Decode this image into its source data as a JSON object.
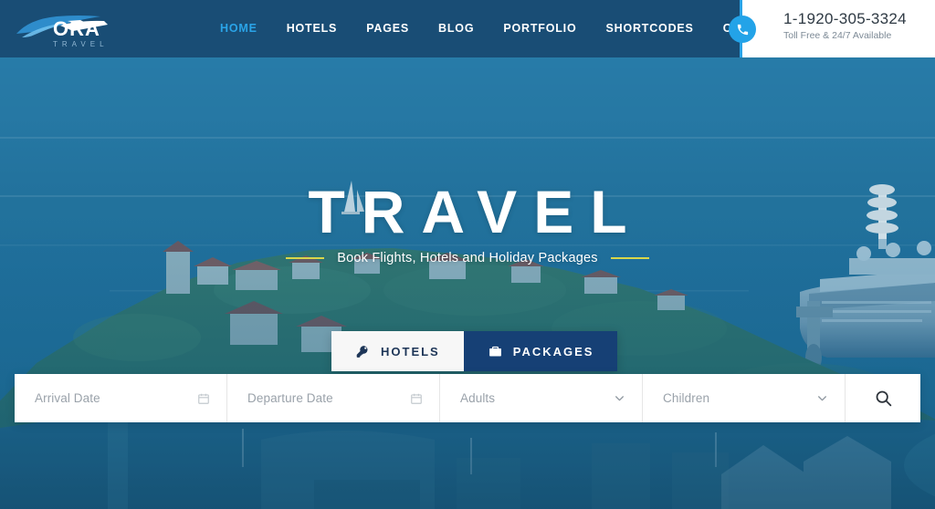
{
  "header": {
    "logo": {
      "name": "ORA",
      "tagline": "TRAVEL",
      "icon": "airplane-logo-icon"
    },
    "nav": [
      {
        "label": "HOME",
        "active": true
      },
      {
        "label": "HOTELS",
        "active": false
      },
      {
        "label": "PAGES",
        "active": false
      },
      {
        "label": "BLOG",
        "active": false
      },
      {
        "label": "PORTFOLIO",
        "active": false
      },
      {
        "label": "SHORTCODES",
        "active": false
      },
      {
        "label": "CONTACT",
        "active": false
      }
    ],
    "phone": {
      "icon": "phone-icon",
      "number": "1-1920-305-3324",
      "subtitle": "Toll Free & 24/7 Available"
    },
    "colors": {
      "bar": "#194d75",
      "active_nav": "#2aa4e8",
      "accent": "#23a3e8"
    }
  },
  "hero": {
    "title": "TRAVEL",
    "subtitle": "Book Flights, Hotels and Holiday Packages",
    "dash_color": "#d9d64a"
  },
  "tabs": [
    {
      "label": "HOTELS",
      "icon": "key-icon",
      "active": true
    },
    {
      "label": "PACKAGES",
      "icon": "briefcase-icon",
      "active": false
    }
  ],
  "search": {
    "fields": [
      {
        "placeholder": "Arrival Date",
        "value": "",
        "icon": "calendar-icon"
      },
      {
        "placeholder": "Departure Date",
        "value": "",
        "icon": "calendar-icon"
      },
      {
        "placeholder": "Adults",
        "value": "",
        "icon": "chevron-down-icon"
      },
      {
        "placeholder": "Children",
        "value": "",
        "icon": "chevron-down-icon"
      }
    ],
    "submit_icon": "search-icon"
  }
}
